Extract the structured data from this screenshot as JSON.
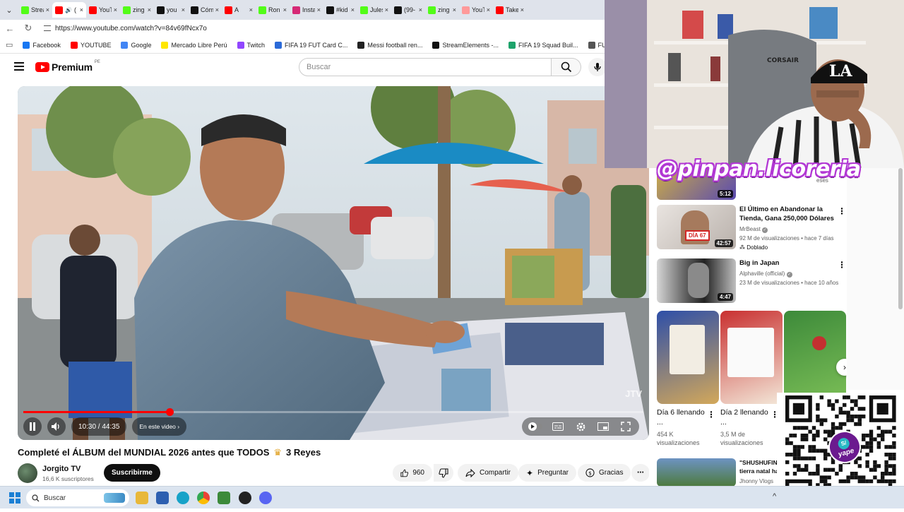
{
  "browser": {
    "tabs": [
      {
        "label": "Strea",
        "icon": "kick-icon",
        "color": "#53fc18"
      },
      {
        "label": "(",
        "icon": "youtube-icon",
        "color": "#ff0000",
        "active": true,
        "audio": true
      },
      {
        "label": "YouT",
        "icon": "youtube-icon",
        "color": "#ff0000"
      },
      {
        "label": "zing",
        "icon": "kick-icon",
        "color": "#53fc18"
      },
      {
        "label": "you",
        "icon": "tiktok-icon",
        "color": "#111111"
      },
      {
        "label": "Cóm",
        "icon": "tiktok-icon",
        "color": "#111111"
      },
      {
        "label": "A",
        "icon": "youtube-icon",
        "color": "#ff0000"
      },
      {
        "label": "Ron",
        "icon": "kick-icon",
        "color": "#53fc18"
      },
      {
        "label": "Insta",
        "icon": "instagram-icon",
        "color": "#d62976"
      },
      {
        "label": "#kid",
        "icon": "tiktok-icon",
        "color": "#111111"
      },
      {
        "label": "Jules",
        "icon": "kick-icon",
        "color": "#53fc18"
      },
      {
        "label": "(99-",
        "icon": "tiktok-icon",
        "color": "#111111"
      },
      {
        "label": "zing",
        "icon": "kick-icon",
        "color": "#53fc18"
      },
      {
        "label": "YouT",
        "icon": "youtube-icon",
        "color": "#ff9a9a"
      },
      {
        "label": "Take",
        "icon": "youtube-icon",
        "color": "#ff0000"
      }
    ],
    "url": "https://www.youtube.com/watch?v=84v69fNcx7o",
    "bookmarks": [
      {
        "label": "Facebook",
        "color": "#1877f2"
      },
      {
        "label": "YOUTUBE",
        "color": "#ff0000"
      },
      {
        "label": "Google",
        "color": "#4285f4"
      },
      {
        "label": "Mercado Libre Perú",
        "color": "#ffe600"
      },
      {
        "label": "Twitch",
        "color": "#9146ff"
      },
      {
        "label": "FIFA 19 FUT Card C...",
        "color": "#2b6ad8"
      },
      {
        "label": "Messi football ren...",
        "color": "#222222"
      },
      {
        "label": "StreamElements -...",
        "color": "#111111"
      },
      {
        "label": "FIFA 19 Squad Buil...",
        "color": "#1ea36b"
      },
      {
        "label": "FUT Web App - EA...",
        "color": "#555555"
      }
    ]
  },
  "youtube": {
    "logo_text": "Premium",
    "country": "PE",
    "search_placeholder": "Buscar",
    "player": {
      "time": "10:30 / 44:35",
      "chapter": "En este video",
      "progress": 0.2354,
      "watermark": "JTV"
    },
    "video_title": "Completé el ÁLBUM del MUNDIAL 2026 antes que TODOS",
    "video_title_suffix": "3 Reyes",
    "channel_name": "Jorgito TV",
    "subscribers": "16,6 K suscriptores",
    "subscribe_label": "Suscribirme",
    "likes": "960",
    "share_label": "Compartir",
    "ask_label": "Preguntar",
    "thanks_label": "Gracias"
  },
  "sidebar": {
    "partial_top": {
      "meta": "eses",
      "duration": "5:12"
    },
    "videos": [
      {
        "title": "El Último en Abandonar la Tienda, Gana 250,000 Dólares",
        "channel": "MrBeast",
        "meta": "92 M de visualizaciones • hace 7 días",
        "badge": "Doblado",
        "duration": "42:57",
        "thumb_text": "DÍA 67"
      },
      {
        "title": "Big in Japan",
        "channel": "Alphaville (official)",
        "meta": "23 M de visualizaciones • hace 10 años",
        "duration": "4:47"
      }
    ],
    "shorts": [
      {
        "title": "Día 6 llenando ...",
        "views": "454 K visualizaciones"
      },
      {
        "title": "Día 2 llenando ...",
        "views": "3,5 M de visualizaciones"
      }
    ],
    "bottom_item": {
      "title": "\"SHUSHUFIN tierra natal ha",
      "channel": "Jhonny Vlogs"
    }
  },
  "overlay": {
    "handle": "@pinpan.licoreria",
    "qr_label": "yape",
    "chair_brand": "CORSAIR",
    "cap_text": "LA"
  },
  "taskbar": {
    "search_placeholder": "Buscar"
  }
}
